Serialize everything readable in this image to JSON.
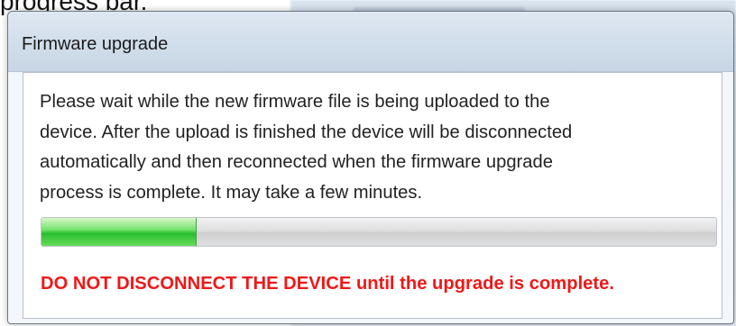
{
  "header_caption": "progress bar.",
  "window": {
    "title": "Firmware upgrade"
  },
  "dialog": {
    "message_lines": [
      "Please wait while the new firmware file is being uploaded to the",
      "device. After the upload is finished the device will be disconnected",
      "automatically and then reconnected when the firmware upgrade",
      "process is complete. It may take a few minutes."
    ],
    "progress_percent": 23,
    "warning": "DO NOT DISCONNECT THE DEVICE until the upgrade is complete."
  }
}
